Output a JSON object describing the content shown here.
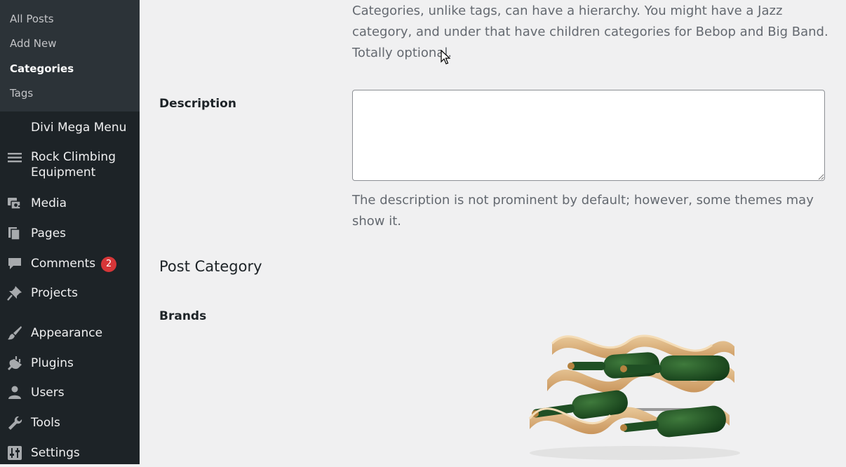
{
  "sidebar": {
    "submenu": [
      {
        "label": "All Posts",
        "current": false
      },
      {
        "label": "Add New",
        "current": false
      },
      {
        "label": "Categories",
        "current": true
      },
      {
        "label": "Tags",
        "current": false
      }
    ],
    "menu": [
      {
        "label": "Divi Mega Menu",
        "icon": "none"
      },
      {
        "label_line1": "Rock Climbing",
        "label_line2": "Equipment",
        "icon": "list-icon"
      },
      {
        "label": "Media",
        "icon": "media-icon"
      },
      {
        "label": "Pages",
        "icon": "pages-icon"
      },
      {
        "label": "Comments",
        "badge": "2",
        "icon": "comment-icon"
      },
      {
        "label": "Projects",
        "icon": "pin-icon"
      },
      {
        "label": "Appearance",
        "icon": "brush-icon"
      },
      {
        "label": "Plugins",
        "icon": "plug-icon"
      },
      {
        "label": "Users",
        "icon": "user-icon"
      },
      {
        "label": "Tools",
        "icon": "wrench-icon"
      },
      {
        "label": "Settings",
        "icon": "settings-icon"
      }
    ]
  },
  "main": {
    "parent_help": "Categories, unlike tags, can have a hierarchy. You might have a Jazz category, and under that have children categories for Bebop and Big Band. Totally optional.",
    "description_label": "Description",
    "description_value": "",
    "description_help": "The description is not prominent by default; however, some themes may show it.",
    "section_title": "Post Category",
    "brands_label": "Brands"
  },
  "colors": {
    "sidebar_bg": "#1d2327",
    "submenu_bg": "#2c3338",
    "badge": "#d63638",
    "page_bg": "#f0f0f1"
  }
}
